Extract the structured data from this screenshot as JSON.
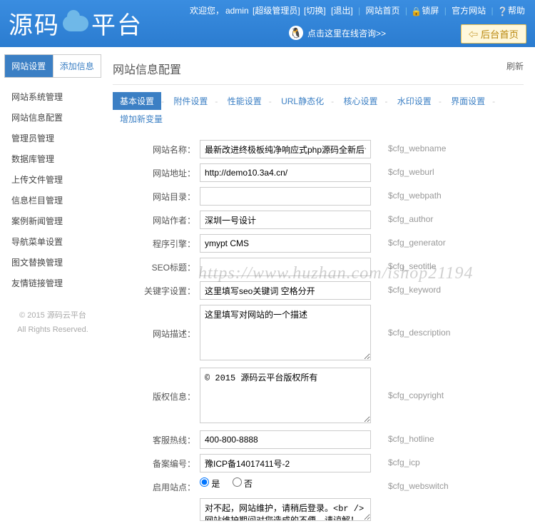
{
  "header": {
    "logo_left": "源码",
    "logo_right": "平台",
    "welcome": "欢迎您，",
    "user": "admin",
    "role": "[超级管理员]",
    "switch": "[切换]",
    "logout": "[退出]",
    "site_home": "网站首页",
    "lock": "锁屏",
    "official": "官方网站",
    "help": "帮助",
    "online_hint": "点击这里在线咨询>>",
    "home_btn": "后台首页"
  },
  "sidebar": {
    "tab1": "网站设置",
    "tab2": "添加信息",
    "menu": [
      "网站系统管理",
      "网站信息配置",
      "管理员管理",
      "数据库管理",
      "上传文件管理",
      "信息栏目管理",
      "案例新闻管理",
      "导航菜单设置",
      "图文替换管理",
      "友情链接管理"
    ],
    "foot1": "© 2015 源码云平台",
    "foot2": "All Rights Reserved."
  },
  "page": {
    "title": "网站信息配置",
    "refresh": "刷新",
    "tabs": [
      "基本设置",
      "附件设置",
      "性能设置",
      "URL静态化",
      "核心设置",
      "水印设置",
      "界面设置",
      "增加新变量"
    ]
  },
  "form": {
    "webname": {
      "label": "网站名称：",
      "value": "最新改进终极板纯净响应式php源码全新后台编辑简单",
      "var": "$cfg_webname"
    },
    "weburl": {
      "label": "网站地址：",
      "value": "http://demo10.3a4.cn/",
      "var": "$cfg_weburl"
    },
    "webpath": {
      "label": "网站目录：",
      "value": "",
      "var": "$cfg_webpath"
    },
    "author": {
      "label": "网站作者：",
      "value": "深圳一号设计",
      "var": "$cfg_author"
    },
    "generator": {
      "label": "程序引擎：",
      "value": "ymypt CMS",
      "var": "$cfg_generator"
    },
    "seotitle": {
      "label": "SEO标题：",
      "value": "",
      "var": "$cfg_seotitle"
    },
    "keyword": {
      "label": "关键字设置：",
      "value": "这里填写seo关键词 空格分开",
      "var": "$cfg_keyword"
    },
    "description": {
      "label": "网站描述：",
      "value": "这里填写对网站的一个描述",
      "var": "$cfg_description"
    },
    "copyright": {
      "label": "版权信息：",
      "value": "© 2015 源码云平台版权所有",
      "var": "$cfg_copyright"
    },
    "hotline": {
      "label": "客服热线：",
      "value": "400-800-8888",
      "var": "$cfg_hotline"
    },
    "icp": {
      "label": "备案编号：",
      "value": "豫ICP备14017411号-2",
      "var": "$cfg_icp"
    },
    "webswitch": {
      "label": "启用站点：",
      "opt_yes": "是",
      "opt_no": "否",
      "var": "$cfg_webswitch"
    },
    "switchshow": {
      "label": "",
      "value": "对不起，网站维护，请稍后登录。<br />网站维护期间对您造成的不便，请谅解！",
      "var": ""
    }
  },
  "watermark": "https://www.huzhan.com/ishop21194"
}
